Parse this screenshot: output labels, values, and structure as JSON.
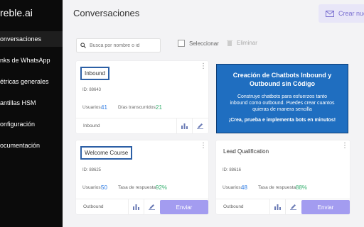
{
  "sidebar": {
    "brand": "reble.ai",
    "items": [
      {
        "label": "onversaciones"
      },
      {
        "label": "nks de WhatsApp"
      },
      {
        "label": "étricas generales"
      },
      {
        "label": "antillas HSM"
      },
      {
        "label": "onfiguración"
      },
      {
        "label": "ocumentación"
      }
    ]
  },
  "header": {
    "title": "Conversaciones",
    "create_label": "Crear nuev"
  },
  "toolbar": {
    "search_placeholder": "Busca por nombre o id",
    "select_label": "Seleccionar",
    "delete_label": "Eliminar"
  },
  "cards": [
    {
      "name": "Inbound",
      "id": "ID: 88643",
      "stat1_label": "Usuarios:",
      "stat1_value": "41",
      "stat2_label": "Días transcurridos:",
      "stat2_value": "21",
      "type": "Inbound"
    },
    {
      "name": "Welcome Course",
      "id": "ID: 88625",
      "stat1_label": "Usuarios:",
      "stat1_value": "50",
      "stat2_label": "Tasa de respuesta:",
      "stat2_value": "92%",
      "type": "Outbound",
      "send_label": "Enviar"
    },
    {
      "name": "Lead Qualification",
      "id": "ID: 88616",
      "stat1_label": "Usuarios:",
      "stat1_value": "48",
      "stat2_label": "Tasa de respuesta:",
      "stat2_value": "88%",
      "type": "Outbound",
      "send_label": "Enviar"
    }
  ],
  "promo": {
    "title": "Creación de Chatbots Inbound y Outbound sin Código",
    "body": "Construye chatbots para esfuerzos tanto inbound como outbound. Puedes crear cuantos quieras de manera sencilla",
    "cta": "¡Crea, prueba e implementa bots en minutos!"
  },
  "colors": {
    "accent": "#a39cf0",
    "users_value": "#2c7be5",
    "rate_value": "#3bb273",
    "promo_bg": "#1f6ec0"
  }
}
